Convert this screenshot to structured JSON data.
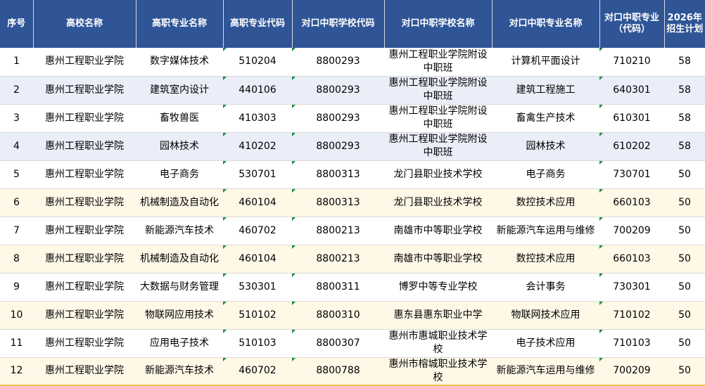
{
  "headers": {
    "seq": "序号",
    "college": "高校名称",
    "major": "高职专业名称",
    "major_code": "高职专业代码",
    "school_code": "对口中职学校代码",
    "school_name": "对口中职学校名称",
    "sec_major": "对口中职专业名称",
    "sec_code": "对口中职专业（代码）",
    "plan": "2026年招生计划"
  },
  "colors": {
    "header_bg": "#2f5597",
    "band_blue": "#e9eef8",
    "band_cream": "#fff8e7",
    "marker": "#1a8a3a"
  },
  "rows": [
    {
      "seq": "1",
      "college": "惠州工程职业学院",
      "major": "数字媒体技术",
      "major_code": "510204",
      "school_code": "8800293",
      "school_name": "惠州工程职业学院附设中职班",
      "sec_major": "计算机平面设计",
      "sec_code": "710210",
      "plan": "58"
    },
    {
      "seq": "2",
      "college": "惠州工程职业学院",
      "major": "建筑室内设计",
      "major_code": "440106",
      "school_code": "8800293",
      "school_name": "惠州工程职业学院附设中职班",
      "sec_major": "建筑工程施工",
      "sec_code": "640301",
      "plan": "58"
    },
    {
      "seq": "3",
      "college": "惠州工程职业学院",
      "major": "畜牧兽医",
      "major_code": "410303",
      "school_code": "8800293",
      "school_name": "惠州工程职业学院附设中职班",
      "sec_major": "畜禽生产技术",
      "sec_code": "610301",
      "plan": "58"
    },
    {
      "seq": "4",
      "college": "惠州工程职业学院",
      "major": "园林技术",
      "major_code": "410202",
      "school_code": "8800293",
      "school_name": "惠州工程职业学院附设中职班",
      "sec_major": "园林技术",
      "sec_code": "610202",
      "plan": "58"
    },
    {
      "seq": "5",
      "college": "惠州工程职业学院",
      "major": "电子商务",
      "major_code": "530701",
      "school_code": "8800313",
      "school_name": "龙门县职业技术学校",
      "sec_major": "电子商务",
      "sec_code": "730701",
      "plan": "50"
    },
    {
      "seq": "6",
      "college": "惠州工程职业学院",
      "major": "机械制造及自动化",
      "major_code": "460104",
      "school_code": "8800313",
      "school_name": "龙门县职业技术学校",
      "sec_major": "数控技术应用",
      "sec_code": "660103",
      "plan": "50"
    },
    {
      "seq": "7",
      "college": "惠州工程职业学院",
      "major": "新能源汽车技术",
      "major_code": "460702",
      "school_code": "8800213",
      "school_name": "南雄市中等职业学校",
      "sec_major": "新能源汽车运用与维修",
      "sec_code": "700209",
      "plan": "50"
    },
    {
      "seq": "8",
      "college": "惠州工程职业学院",
      "major": "机械制造及自动化",
      "major_code": "460104",
      "school_code": "8800213",
      "school_name": "南雄市中等职业学校",
      "sec_major": "数控技术应用",
      "sec_code": "660103",
      "plan": "50"
    },
    {
      "seq": "9",
      "college": "惠州工程职业学院",
      "major": "大数据与财务管理",
      "major_code": "530301",
      "school_code": "8800311",
      "school_name": "博罗中等专业学校",
      "sec_major": "会计事务",
      "sec_code": "730301",
      "plan": "50"
    },
    {
      "seq": "10",
      "college": "惠州工程职业学院",
      "major": "物联网应用技术",
      "major_code": "510102",
      "school_code": "8800310",
      "school_name": "惠东县惠东职业中学",
      "sec_major": "物联网技术应用",
      "sec_code": "710102",
      "plan": "50"
    },
    {
      "seq": "11",
      "college": "惠州工程职业学院",
      "major": "应用电子技术",
      "major_code": "510103",
      "school_code": "8800307",
      "school_name": "惠州市惠城职业技术学校",
      "sec_major": "电子技术应用",
      "sec_code": "710103",
      "plan": "50"
    },
    {
      "seq": "12",
      "college": "惠州工程职业学院",
      "major": "新能源汽车技术",
      "major_code": "460702",
      "school_code": "8800788",
      "school_name": "惠州市榕城职业技术学校",
      "sec_major": "新能源汽车运用与维修",
      "sec_code": "700209",
      "plan": "50"
    }
  ]
}
